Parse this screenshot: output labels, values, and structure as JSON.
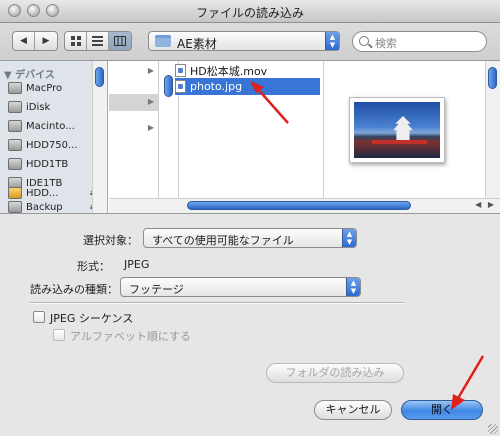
{
  "window": {
    "title": "ファイルの読み込み"
  },
  "toolbar": {
    "nav_back": "◀",
    "nav_forward": "▶",
    "folder_name": "AE素材",
    "search_placeholder": "検索"
  },
  "sidebar": {
    "section_label": "▼ デバイス",
    "items": [
      {
        "label": "MacPro"
      },
      {
        "label": "iDisk"
      },
      {
        "label": "Macinto..."
      },
      {
        "label": "HDD750..."
      },
      {
        "label": "HDD1TB"
      },
      {
        "label": "IDE1TB"
      },
      {
        "label": "HDD..."
      },
      {
        "label": "Backup"
      }
    ]
  },
  "files": [
    {
      "name": "HD松本城.mov",
      "selected": false
    },
    {
      "name": "photo.jpg",
      "selected": true
    }
  ],
  "options": {
    "filter_label": "選択対象：",
    "filter_value": "すべての使用可能なファイル",
    "format_label": "形式：",
    "format_value": "JPEG",
    "import_type_label": "読み込みの種類：",
    "import_type_value": "フッテージ",
    "sequence_label": "JPEG シーケンス",
    "alpha_order_label": "アルファベット順にする",
    "import_folder_button": "フォルダの読み込み"
  },
  "buttons": {
    "cancel": "キャンセル",
    "open": "開く"
  },
  "colors": {
    "selection": "#3875d7",
    "annotation_arrow": "#e0201b"
  }
}
